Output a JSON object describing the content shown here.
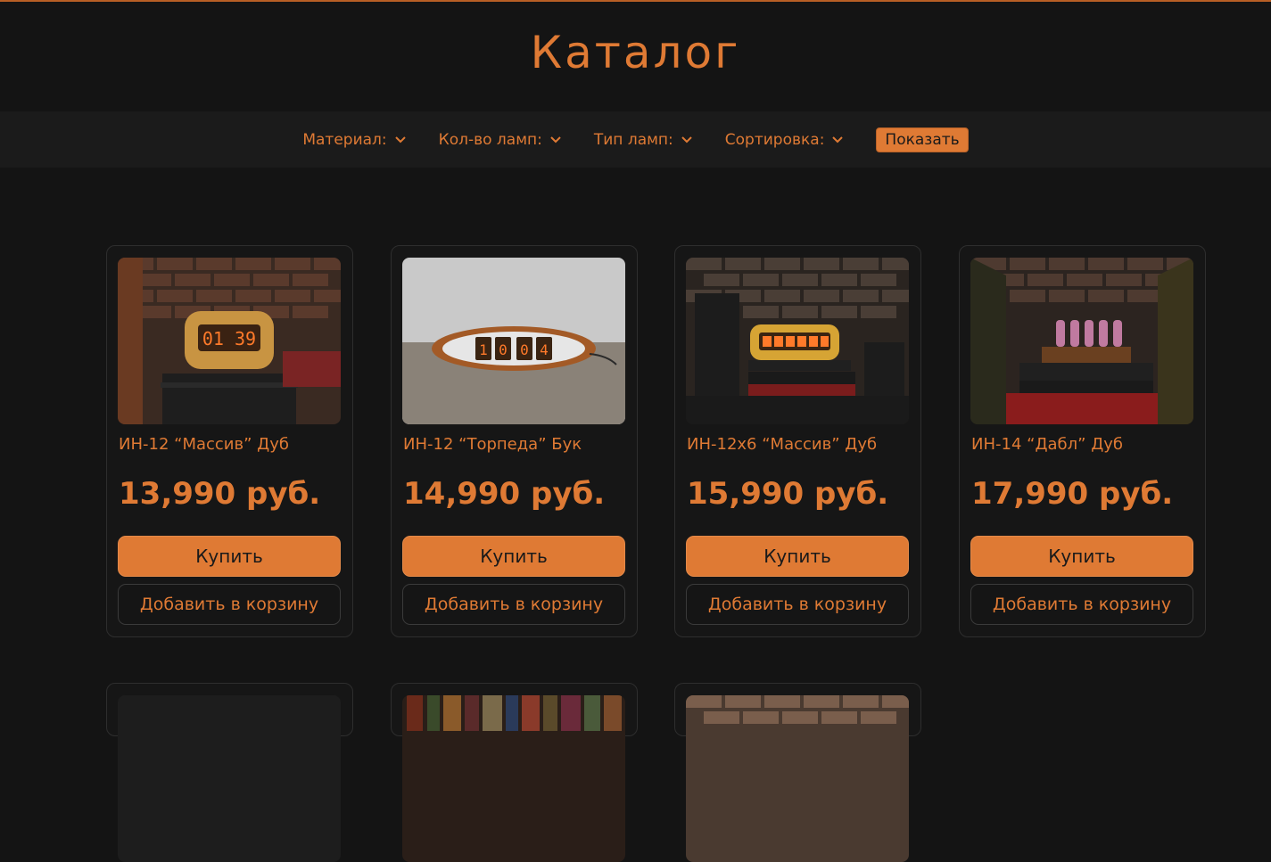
{
  "page": {
    "title": "Каталог"
  },
  "filters": {
    "items": [
      {
        "label": "Материал:"
      },
      {
        "label": "Кол-во ламп:"
      },
      {
        "label": "Тип ламп:"
      },
      {
        "label": "Сортировка:"
      }
    ],
    "show_label": "Показать"
  },
  "products": [
    {
      "name": "ИН-12 “Массив” Дуб",
      "price": "13,990 руб.",
      "buy_label": "Купить",
      "cart_label": "Добавить в корзину",
      "display": "01 39"
    },
    {
      "name": "ИН-12 “Торпеда” Бук",
      "price": "14,990 руб.",
      "buy_label": "Купить",
      "cart_label": "Добавить в корзину",
      "display": "1004"
    },
    {
      "name": "ИН-12х6 “Массив” Дуб",
      "price": "15,990 руб.",
      "buy_label": "Купить",
      "cart_label": "Добавить в корзину",
      "display": ""
    },
    {
      "name": "ИН-14 “Дабл” Дуб",
      "price": "17,990 руб.",
      "buy_label": "Купить",
      "cart_label": "Добавить в корзину",
      "display": ""
    }
  ],
  "colors": {
    "accent": "#df7a34",
    "background": "#141414",
    "bar": "#1b1b1b",
    "card": "#161616"
  }
}
